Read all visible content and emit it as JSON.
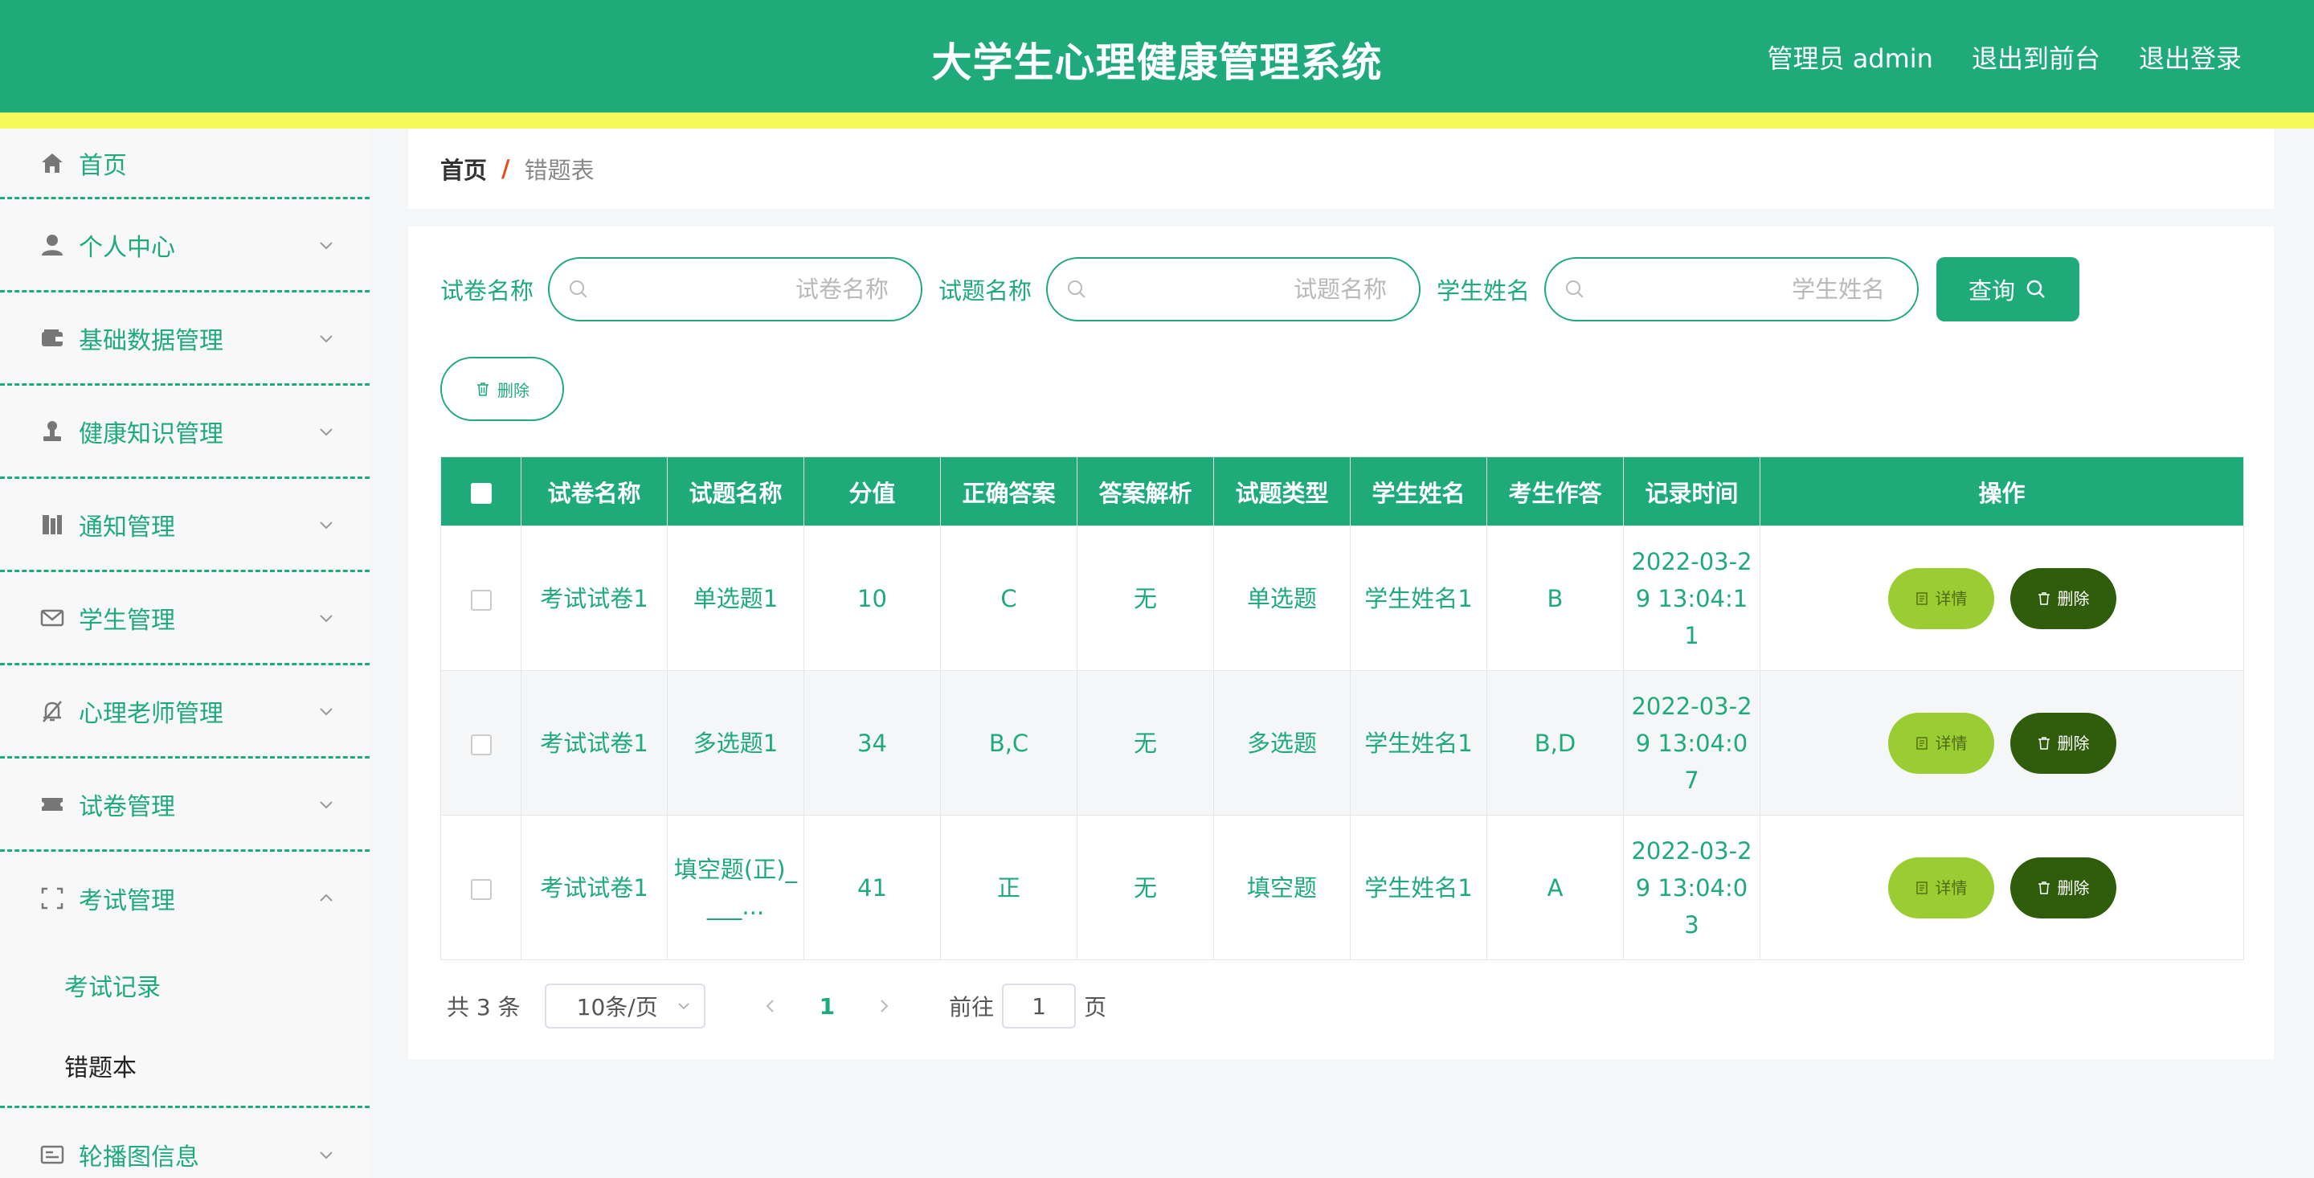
{
  "header": {
    "title": "大学生心理健康管理系统",
    "admin_label": "管理员 admin",
    "to_front_label": "退出到前台",
    "logout_label": "退出登录"
  },
  "sidebar": {
    "items": [
      {
        "label": "首页",
        "icon": "home-icon"
      },
      {
        "label": "个人中心",
        "icon": "user-icon"
      },
      {
        "label": "基础数据管理",
        "icon": "wallet-icon"
      },
      {
        "label": "健康知识管理",
        "icon": "stamp-icon"
      },
      {
        "label": "通知管理",
        "icon": "book-icon"
      },
      {
        "label": "学生管理",
        "icon": "mail-icon"
      },
      {
        "label": "心理老师管理",
        "icon": "bell-off-icon"
      },
      {
        "label": "试卷管理",
        "icon": "ticket-icon"
      },
      {
        "label": "考试管理",
        "icon": "frame-icon"
      },
      {
        "label": "轮播图信息",
        "icon": "card-icon"
      }
    ],
    "sub_items": [
      "考试记录",
      "错题本"
    ]
  },
  "breadcrumb": {
    "home": "首页",
    "separator": "/",
    "current": "错题表"
  },
  "search": {
    "paper_label": "试卷名称",
    "paper_placeholder": "试卷名称",
    "question_label": "试题名称",
    "question_placeholder": "试题名称",
    "student_label": "学生姓名",
    "student_placeholder": "学生姓名",
    "query_label": "查询"
  },
  "toolbar": {
    "delete_label": "删除"
  },
  "table": {
    "headers": [
      "试卷名称",
      "试题名称",
      "分值",
      "正确答案",
      "答案解析",
      "试题类型",
      "学生姓名",
      "考生作答",
      "记录时间",
      "操作"
    ],
    "rows": [
      {
        "paper": "考试试卷1",
        "question": "单选题1",
        "score": "10",
        "answer": "C",
        "analysis": "无",
        "type": "单选题",
        "student": "学生姓名1",
        "response": "B",
        "time": "2022-03-29 13:04:11"
      },
      {
        "paper": "考试试卷1",
        "question": "多选题1",
        "score": "34",
        "answer": "B,C",
        "analysis": "无",
        "type": "多选题",
        "student": "学生姓名1",
        "response": "B,D",
        "time": "2022-03-29 13:04:07"
      },
      {
        "paper": "考试试卷1",
        "question": "填空题(正)____...",
        "score": "41",
        "answer": "正",
        "analysis": "无",
        "type": "填空题",
        "student": "学生姓名1",
        "response": "A",
        "time": "2022-03-29 13:04:03"
      }
    ],
    "detail_label": "详情",
    "delete_label": "删除"
  },
  "pagination": {
    "total_text": "共 3 条",
    "page_size": "10条/页",
    "current_page": "1",
    "goto_label": "前往",
    "goto_value": "1",
    "page_suffix": "页"
  },
  "colors": {
    "primary": "#1fab79",
    "stripe": "#f6fb5c",
    "detail_button": "#9acd32",
    "delete_button": "#2f5d0c",
    "breadcrumb_separator": "#e84b1e"
  }
}
